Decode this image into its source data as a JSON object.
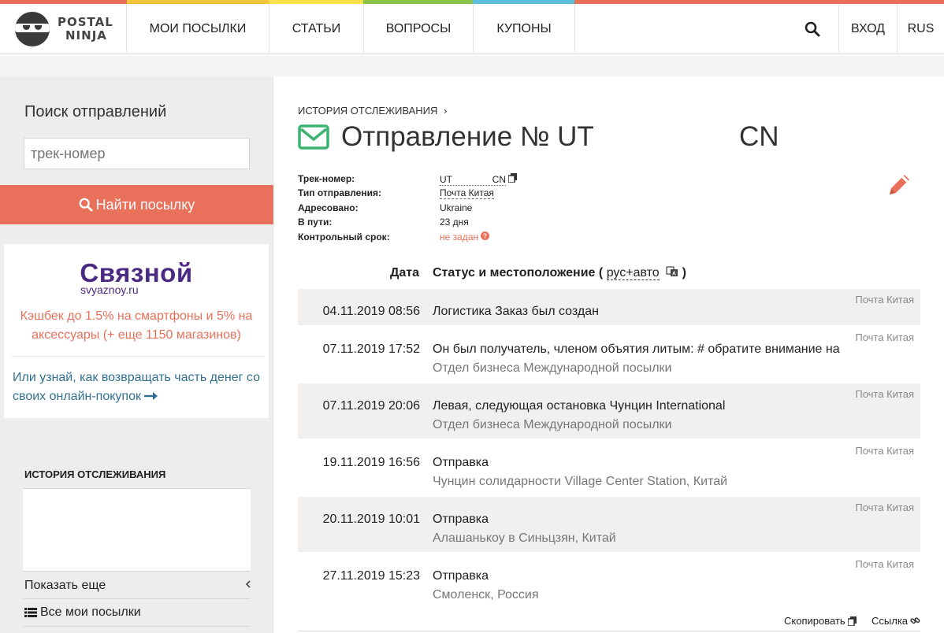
{
  "colors": {
    "stripe": [
      "#e9705a",
      "#f3c53a",
      "#f7e04b",
      "#8bc34a",
      "#5bc0de",
      "#e9705a"
    ],
    "accent": "#e9705a",
    "green_icon": "#3cb371",
    "brand_purple": "#4a2a83"
  },
  "header": {
    "logo_line1": "POSTAL",
    "logo_line2": "NINJA",
    "nav": [
      "МОИ ПОСЫЛКИ",
      "СТАТЬИ",
      "ВОПРОСЫ",
      "КУПОНЫ"
    ],
    "login": "ВХОД",
    "lang": "RUS",
    "search_icon": "search-icon"
  },
  "sidebar": {
    "title": "Поиск отправлений",
    "input_placeholder": "трек-номер",
    "search_button": "Найти посылку",
    "promo": {
      "brand": "Связной",
      "url": "svyaznoy.ru",
      "cashback": "Кэшбек до 1.5% на смартфоны и 5% на аксессуары (+ еще 1150 магазинов)",
      "link": "Или узнай, как возвращать часть денег со своих онлайн-покупок"
    },
    "history_title": "ИСТОРИЯ ОТСЛЕЖИВАНИЯ",
    "show_more": "Показать еще",
    "all_parcels": "Все мои посылки"
  },
  "main": {
    "breadcrumb": "ИСТОРИЯ ОТСЛЕЖИВАНИЯ",
    "title_start": "Отправление № UT",
    "title_end": "CN",
    "info": [
      {
        "key": "Трек-номер:",
        "value": "UT",
        "suffix": "CN"
      },
      {
        "key": "Тип отправления:",
        "value": "Почта Китая"
      },
      {
        "key": "Адресовано:",
        "value": "Ukraine"
      },
      {
        "key": "В пути:",
        "value": "23 дня"
      },
      {
        "key": "Контрольный срок:",
        "value": "не задан"
      }
    ],
    "table_header": {
      "date": "Дата",
      "status": "Статус и местоположение (",
      "lang_mode": "рус+авто",
      "close": ")"
    },
    "events": [
      {
        "source": "Почта Китая",
        "date": "04.11.2019 08:56",
        "title": "Логистика Заказ был создан",
        "location": ""
      },
      {
        "source": "Почта Китая",
        "date": "07.11.2019 17:52",
        "title": "Он был получатель, членом объятия литым: # обратите внимание на",
        "location": "Отдел бизнеса Международной посылки"
      },
      {
        "source": "Почта Китая",
        "date": "07.11.2019 20:06",
        "title": "Левая, следующая остановка Чунцин International",
        "location": "Отдел бизнеса Международной посылки"
      },
      {
        "source": "Почта Китая",
        "date": "19.11.2019 16:56",
        "title": "Отправка",
        "location": "Чунцин солидарности Village Center Station, Китай"
      },
      {
        "source": "Почта Китая",
        "date": "20.11.2019 10:01",
        "title": "Отправка",
        "location": "Алашанькоу в Синьцзян, Китай"
      },
      {
        "source": "Почта Китая",
        "date": "27.11.2019 15:23",
        "title": "Отправка",
        "location": "Смоленск, Россия"
      }
    ],
    "copy_label": "Скопировать",
    "link_label": "Ссылка"
  }
}
